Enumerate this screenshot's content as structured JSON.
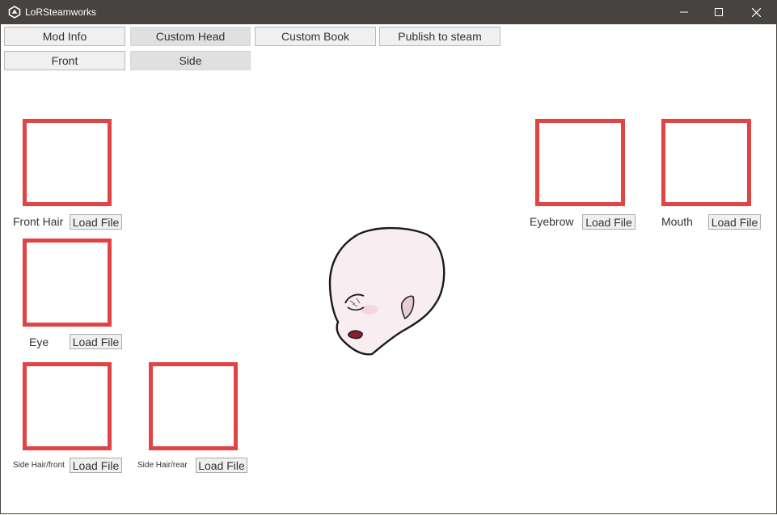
{
  "window": {
    "title": "LoRSteamworks",
    "icon": "unity-logo-icon",
    "controls": [
      "minimize-icon",
      "maximize-icon",
      "close-icon"
    ]
  },
  "tabs": {
    "mod_info": "Mod Info",
    "custom_head": "Custom Head",
    "custom_book": "Custom Book",
    "publish": "Publish to steam"
  },
  "view_tabs": {
    "front": "Front",
    "side": "Side"
  },
  "slots": {
    "front_hair": {
      "label": "Front Hair",
      "button": "Load File"
    },
    "eye": {
      "label": "Eye",
      "button": "Load File"
    },
    "side_hair_front": {
      "label": "Side Hair/front",
      "button": "Load File"
    },
    "side_hair_rear": {
      "label": "Side Hair/rear",
      "button": "Load File"
    },
    "eyebrow": {
      "label": "Eyebrow",
      "button": "Load File"
    },
    "mouth": {
      "label": "Mouth",
      "button": "Load File"
    }
  },
  "colors": {
    "titlebar": "#474340",
    "slot_border": "#e04445",
    "active_tab": "#e0e0e0"
  }
}
